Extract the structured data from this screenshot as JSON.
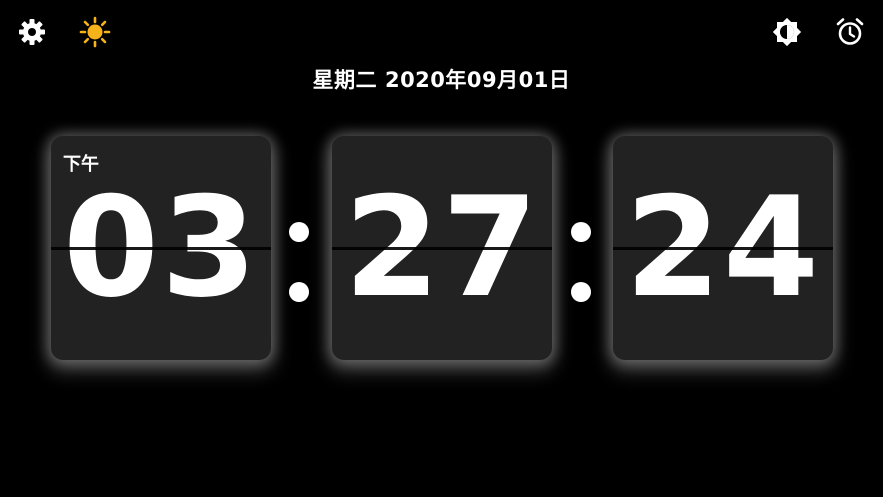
{
  "toolbar": {
    "left_icons": [
      "gear-icon",
      "sun-icon"
    ],
    "right_icons": [
      "brightness-icon",
      "alarm-icon"
    ],
    "sun_color": "#F5B21B"
  },
  "date_text": "星期二  2020年09月01日",
  "clock": {
    "period": "下午",
    "hours": "03",
    "minutes": "27",
    "seconds": "24",
    "separator": ":"
  }
}
